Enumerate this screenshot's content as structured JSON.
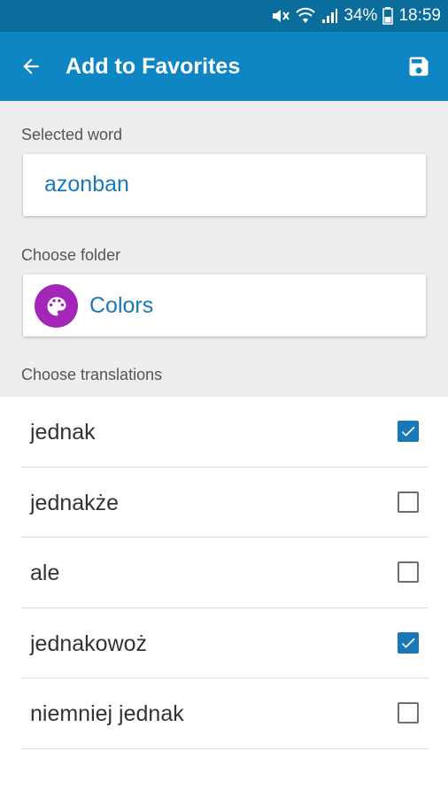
{
  "status_bar": {
    "battery": "34%",
    "time": "18:59",
    "icons": [
      "mute-icon",
      "wifi-icon",
      "signal-icon",
      "battery-icon"
    ]
  },
  "app_bar": {
    "title": "Add to Favorites",
    "back_icon": "arrow-back-icon",
    "save_icon": "save-icon"
  },
  "form": {
    "selected_word_label": "Selected word",
    "selected_word": "azonban",
    "choose_folder_label": "Choose folder",
    "folder": {
      "name": "Colors",
      "icon": "palette-icon",
      "color": "#a326b8"
    },
    "choose_translations_label": "Choose translations"
  },
  "translations": [
    {
      "text": "jednak",
      "checked": true
    },
    {
      "text": "jednakże",
      "checked": false
    },
    {
      "text": "ale",
      "checked": false
    },
    {
      "text": "jednakowoż",
      "checked": true
    },
    {
      "text": "niemniej jednak",
      "checked": false
    }
  ],
  "colors": {
    "status_bar": "#0b6d9c",
    "app_bar": "#0f86c4",
    "accent": "#1a78b8",
    "folder": "#a326b8"
  }
}
